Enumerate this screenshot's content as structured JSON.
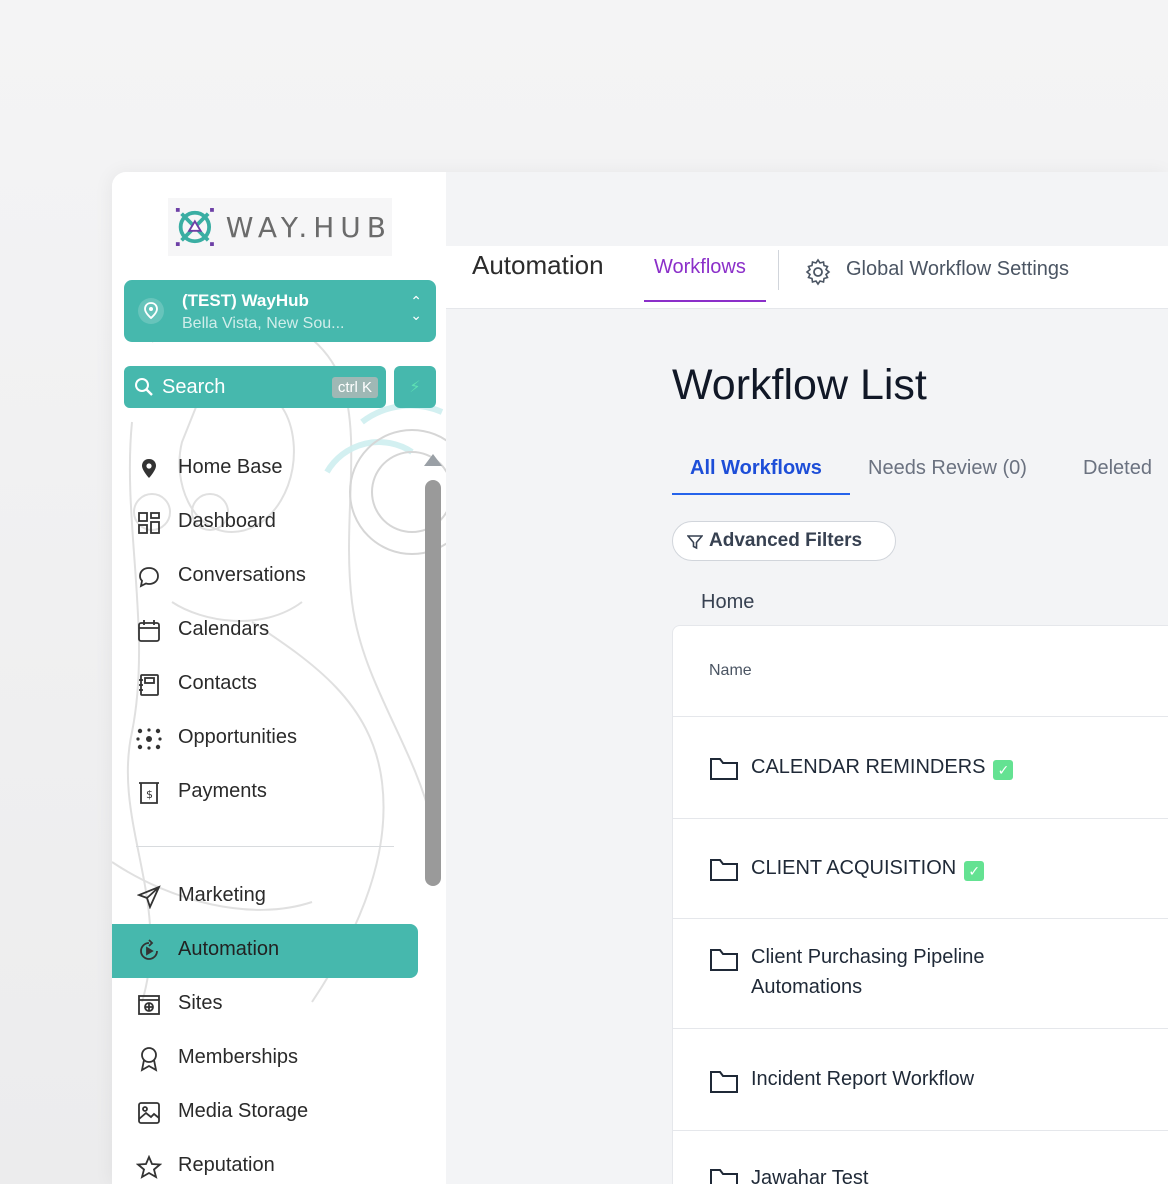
{
  "brand": {
    "name": "WAY.HUB",
    "accent": "#46b8ad",
    "purple": "#8b2fc9",
    "blue": "#2563eb"
  },
  "location": {
    "name": "(TEST) WayHub",
    "address": "Bella Vista, New Sou..."
  },
  "search": {
    "label": "Search",
    "shortcut": "ctrl K"
  },
  "nav": {
    "items": [
      {
        "label": "Home Base",
        "icon": "map-pin-icon"
      },
      {
        "label": "Dashboard",
        "icon": "grid-icon"
      },
      {
        "label": "Conversations",
        "icon": "chat-bubble-icon"
      },
      {
        "label": "Calendars",
        "icon": "calendar-icon"
      },
      {
        "label": "Contacts",
        "icon": "contact-book-icon"
      },
      {
        "label": "Opportunities",
        "icon": "network-icon"
      },
      {
        "label": "Payments",
        "icon": "receipt-icon"
      },
      {
        "label": "Marketing",
        "icon": "paper-plane-icon"
      },
      {
        "label": "Automation",
        "icon": "automation-icon"
      },
      {
        "label": "Sites",
        "icon": "globe-window-icon"
      },
      {
        "label": "Memberships",
        "icon": "award-icon"
      },
      {
        "label": "Media Storage",
        "icon": "image-icon"
      },
      {
        "label": "Reputation",
        "icon": "star-icon"
      }
    ],
    "active": "Automation"
  },
  "header": {
    "title": "Automation",
    "tab_workflows": "Workflows",
    "global_settings": "Global Workflow Settings"
  },
  "main": {
    "page_title": "Workflow List",
    "tabs": [
      "All Workflows",
      "Needs Review (0)",
      "Deleted"
    ],
    "active_tab": "All Workflows",
    "filter_label": "Advanced Filters",
    "breadcrumb": "Home",
    "table": {
      "column_name": "Name",
      "rows": [
        {
          "name": "CALENDAR REMINDERS",
          "checked": true
        },
        {
          "name": "CLIENT ACQUISITION",
          "checked": true
        },
        {
          "name_line1": "Client Purchasing Pipeline",
          "name_line2": "Automations",
          "checked": false
        },
        {
          "name": "Incident Report Workflow",
          "checked": false
        },
        {
          "name": "Jawahar Test",
          "checked": false
        }
      ]
    }
  }
}
